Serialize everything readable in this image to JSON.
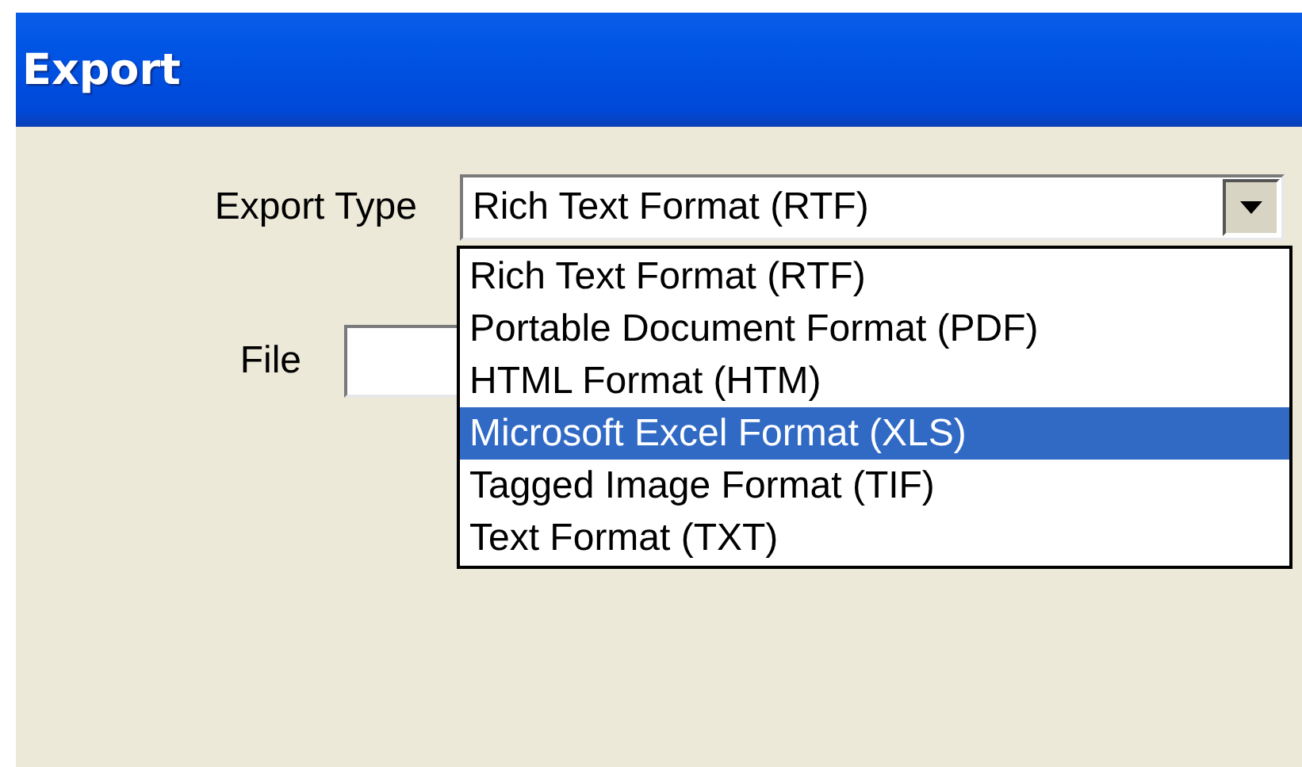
{
  "window": {
    "title": "Export"
  },
  "export_type": {
    "label": "Export Type",
    "value": "Rich Text Format (RTF)",
    "expanded": true,
    "options": [
      {
        "label": "Rich Text Format (RTF)",
        "highlighted": false
      },
      {
        "label": "Portable Document Format (PDF)",
        "highlighted": false
      },
      {
        "label": "HTML Format (HTM)",
        "highlighted": false
      },
      {
        "label": "Microsoft Excel Format (XLS)",
        "highlighted": true
      },
      {
        "label": "Tagged Image Format (TIF)",
        "highlighted": false
      },
      {
        "label": "Text Format (TXT)",
        "highlighted": false
      }
    ]
  },
  "file": {
    "label": "File"
  }
}
